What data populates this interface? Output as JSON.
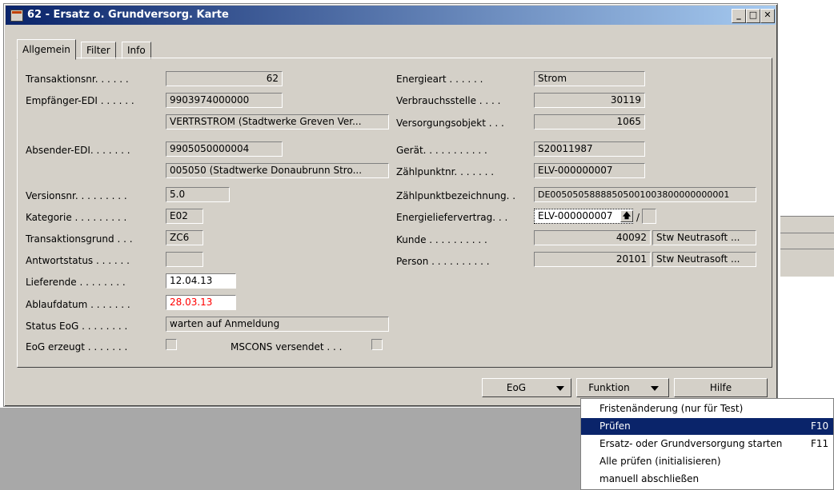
{
  "window": {
    "title": "62 - Ersatz o. Grundversorg. Karte",
    "controls": {
      "minimize": "_",
      "maximize": "□",
      "close": "✕"
    }
  },
  "tabs": [
    "Allgemein",
    "Filter",
    "Info"
  ],
  "left": {
    "transaktionsnr": {
      "label": "Transaktionsnr. . . . . .",
      "value": "62"
    },
    "empfaenger": {
      "label": "Empfänger-EDI . . . . . .",
      "value": "9903974000000",
      "desc": "VERTRSTROM (Stadtwerke Greven Ver..."
    },
    "absender": {
      "label": "Absender-EDI. . . . . . .",
      "value": "9905050000004",
      "desc": "005050 (Stadtwerke Donaubrunn Stro..."
    },
    "versionsnr": {
      "label": "Versionsnr. . . . . . . . .",
      "value": "5.0"
    },
    "kategorie": {
      "label": "Kategorie . . . . . . . . .",
      "value": "E02"
    },
    "transaktionsgrund": {
      "label": "Transaktionsgrund . . .",
      "value": "ZC6"
    },
    "antwortstatus": {
      "label": "Antwortstatus . . . . . .",
      "value": ""
    },
    "lieferende": {
      "label": "Lieferende . . . . . . . .",
      "value": "12.04.13"
    },
    "ablaufdatum": {
      "label": "Ablaufdatum . . . . . . .",
      "value": "28.03.13"
    },
    "status_eog": {
      "label": "Status EoG . . . . . . . .",
      "value": "warten auf Anmeldung"
    },
    "eog_erzeugt": {
      "label": "EoG erzeugt . . . . . . ."
    },
    "mscons": {
      "label": "MSCONS versendet . . ."
    }
  },
  "right": {
    "energieart": {
      "label": "Energieart . . . . . .",
      "value": "Strom"
    },
    "verbrauchsstelle": {
      "label": "Verbrauchsstelle . . . .",
      "value": "30119"
    },
    "versorgungsobjekt": {
      "label": "Versorgungsobjekt . . .",
      "value": "1065"
    },
    "geraet": {
      "label": "Gerät. . . . . . . . . . .",
      "value": "S20011987"
    },
    "zaehlpunktnr": {
      "label": "Zählpunktnr. . . . . . .",
      "value": "ELV-000000007"
    },
    "zaehlpunktbez": {
      "label": "Zählpunktbezeichnung. .",
      "value": "DE00505058888505001003800000000001"
    },
    "energieliefervertrag": {
      "label": "Energieliefervertrag. . .",
      "value": "ELV-000000007",
      "slash": "/",
      "value2": ""
    },
    "kunde": {
      "label": "Kunde . . . . . . . . . .",
      "value": "40092",
      "name": "Stw Neutrasoft ..."
    },
    "person": {
      "label": "Person . . . . . . . . . .",
      "value": "20101",
      "name": "Stw Neutrasoft ..."
    }
  },
  "buttons": {
    "eog": "EoG",
    "funktion": "Funktion",
    "hilfe": "Hilfe"
  },
  "menu": [
    {
      "label": "Fristenänderung (nur für Test)",
      "key": ""
    },
    {
      "label": "Prüfen",
      "key": "F10"
    },
    {
      "label": "Ersatz- oder Grundversorgung starten",
      "key": "F11"
    },
    {
      "label": "Alle prüfen (initialisieren)",
      "key": ""
    },
    {
      "label": "manuell abschließen",
      "key": ""
    }
  ],
  "colors": {
    "ablaufdatum_text": "#ff0000",
    "selection": "#0a246a"
  }
}
